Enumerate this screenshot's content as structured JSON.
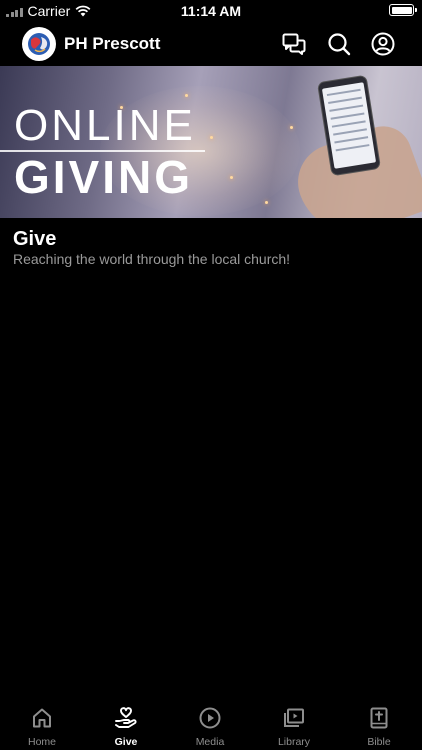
{
  "status_bar": {
    "carrier": "Carrier",
    "time": "11:14 AM"
  },
  "header": {
    "title": "PH Prescott"
  },
  "banner": {
    "line1": "ONLINE",
    "line2": "GIVING"
  },
  "content": {
    "title": "Give",
    "subtitle": "Reaching the world through the local church!"
  },
  "tabs": [
    {
      "label": "Home",
      "icon": "home-icon"
    },
    {
      "label": "Give",
      "icon": "give-hand-heart-icon",
      "active": true
    },
    {
      "label": "Media",
      "icon": "play-circle-icon"
    },
    {
      "label": "Library",
      "icon": "library-icon"
    },
    {
      "label": "Bible",
      "icon": "bible-icon"
    }
  ],
  "colors": {
    "background": "#000000",
    "active_tab": "#ffffff",
    "inactive_tab": "#8e8e8e",
    "subtitle": "#9a9a9a"
  }
}
